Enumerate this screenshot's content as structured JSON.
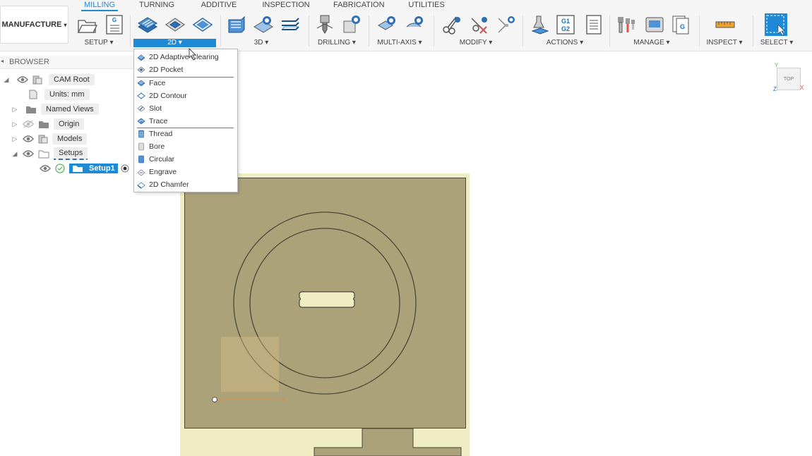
{
  "workspace": {
    "label": "MANUFACTURE"
  },
  "tabs": [
    "MILLING",
    "TURNING",
    "ADDITIVE",
    "INSPECTION",
    "FABRICATION",
    "UTILITIES"
  ],
  "groups": [
    "SETUP",
    "2D",
    "3D",
    "DRILLING",
    "MULTI-AXIS",
    "MODIFY",
    "ACTIONS",
    "MANAGE",
    "INSPECT",
    "SELECT"
  ],
  "browser": {
    "title": "BROWSER",
    "items": [
      "CAM Root",
      "Units: mm",
      "Named Views",
      "Origin",
      "Models",
      "Setups",
      "Setup1"
    ]
  },
  "menu_2d": {
    "items": [
      "2D Adaptive Clearing",
      "2D Pocket",
      "Face",
      "2D Contour",
      "Slot",
      "Trace",
      "Thread",
      "Bore",
      "Circular",
      "Engrave",
      "2D Chamfer"
    ]
  },
  "viewcube": {
    "label": "TOP",
    "axis_y": "Y",
    "axis_x": "X",
    "axis_z": "Z"
  },
  "colors": {
    "accent": "#1e8ad6",
    "stock": "#f0edc4",
    "part": "#aca27a"
  }
}
